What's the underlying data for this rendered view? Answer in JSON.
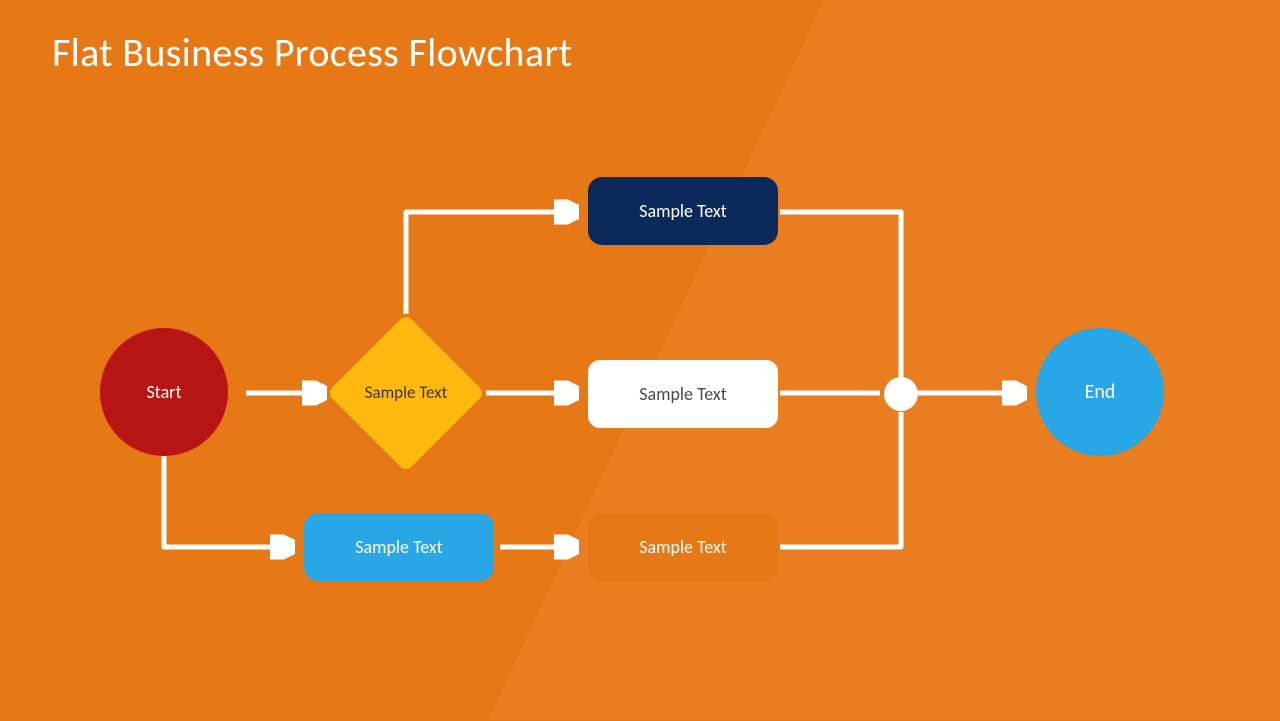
{
  "title": "Flat Business Process Flowchart",
  "nodes": {
    "start": {
      "label": "Start"
    },
    "decision": {
      "label": "Sample Text"
    },
    "top": {
      "label": "Sample Text"
    },
    "mid": {
      "label": "Sample Text"
    },
    "bot": {
      "label": "Sample Text"
    },
    "sky": {
      "label": "Sample Text"
    },
    "end": {
      "label": "End"
    }
  },
  "colors": {
    "background": "#E77816",
    "start": "#B81414",
    "decision": "#FFB90F",
    "navy": "#0B2A5B",
    "white": "#FFFFFF",
    "sky": "#29A6E5",
    "orange": "#E77816",
    "end": "#29A6E5",
    "connector": "#FFFFFF"
  },
  "flow_edges": [
    [
      "start",
      "decision"
    ],
    [
      "decision",
      "top"
    ],
    [
      "decision",
      "mid"
    ],
    [
      "start",
      "sky"
    ],
    [
      "sky",
      "bot"
    ],
    [
      "top",
      "merge"
    ],
    [
      "mid",
      "merge"
    ],
    [
      "bot",
      "merge"
    ],
    [
      "merge",
      "end"
    ]
  ]
}
